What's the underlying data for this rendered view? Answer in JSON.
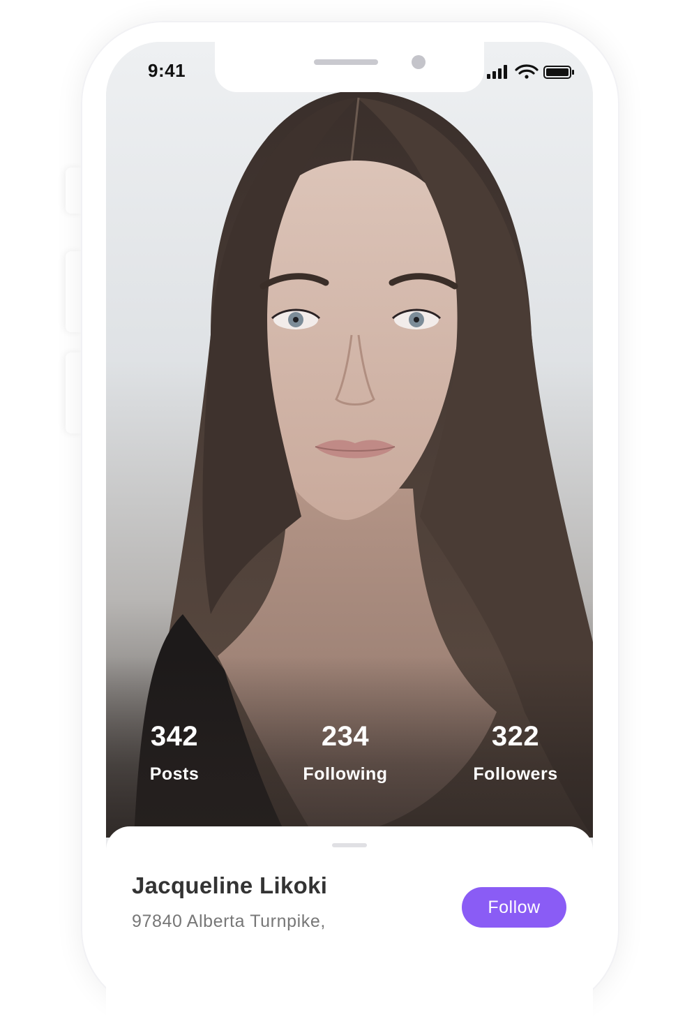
{
  "status_bar": {
    "time": "9:41",
    "icons": [
      "cellular-signal-icon",
      "wifi-icon",
      "battery-icon"
    ]
  },
  "profile": {
    "photo_description": "portrait-photo",
    "stats": [
      {
        "value": "342",
        "label": "Posts"
      },
      {
        "value": "234",
        "label": "Following"
      },
      {
        "value": "322",
        "label": "Followers"
      }
    ],
    "name": "Jacqueline Likoki",
    "address": "97840 Alberta Turnpike,",
    "follow_label": "Follow"
  },
  "colors": {
    "accent": "#8a5cf5",
    "name_text": "#333333",
    "address_text": "#777777"
  }
}
